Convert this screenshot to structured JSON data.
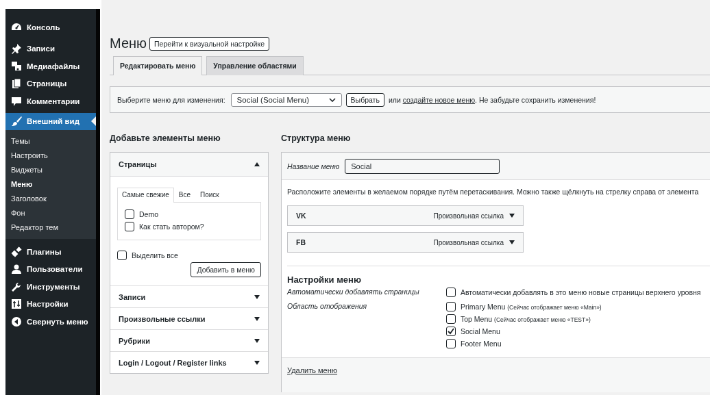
{
  "sidebar": {
    "items": [
      {
        "label": "Консоль",
        "selected": false
      },
      {
        "label": "Записи",
        "selected": false
      },
      {
        "label": "Медиафайлы",
        "selected": false
      },
      {
        "label": "Страницы",
        "selected": false
      },
      {
        "label": "Комментарии",
        "selected": false
      },
      {
        "label": "Внешний вид",
        "selected": true,
        "children": [
          {
            "label": "Темы",
            "selected": false
          },
          {
            "label": "Настроить",
            "selected": false
          },
          {
            "label": "Виджеты",
            "selected": false
          },
          {
            "label": "Меню",
            "selected": true
          },
          {
            "label": "Заголовок",
            "selected": false
          },
          {
            "label": "Фон",
            "selected": false
          },
          {
            "label": "Редактор тем",
            "selected": false
          }
        ]
      },
      {
        "label": "Плагины",
        "selected": false
      },
      {
        "label": "Пользователи",
        "selected": false
      },
      {
        "label": "Инструменты",
        "selected": false
      },
      {
        "label": "Настройки",
        "selected": false
      },
      {
        "label": "Свернуть меню",
        "selected": false
      }
    ]
  },
  "page": {
    "title": "Меню",
    "action_button": "Перейти к визуальной настройке"
  },
  "tabs": [
    {
      "label": "Редактировать меню",
      "selected": true
    },
    {
      "label": "Управление областями",
      "selected": false
    }
  ],
  "menu_select": {
    "label": "Выберите меню для изменения:",
    "value": "Social (Social Menu)",
    "button": "Выбрать",
    "note_before": "или ",
    "link": "создайте новое меню",
    "note_after": ". Не забудьте сохранить изменения!"
  },
  "add_items": {
    "heading": "Добавьте элементы меню",
    "sections": [
      {
        "title": "Страницы",
        "expanded": true,
        "tabs": [
          {
            "label": "Самые свежие",
            "selected": true
          },
          {
            "label": "Все",
            "selected": false
          },
          {
            "label": "Поиск",
            "selected": false
          }
        ],
        "pages": [
          {
            "label": "Demo",
            "checked": false
          },
          {
            "label": "Как стать автором?",
            "checked": false
          }
        ],
        "select_all": {
          "label": "Выделить все",
          "checked": false
        },
        "add_button": "Добавить в меню"
      },
      {
        "title": "Записи",
        "expanded": false
      },
      {
        "title": "Произвольные ссылки",
        "expanded": false
      },
      {
        "title": "Рубрики",
        "expanded": false
      },
      {
        "title": "Login / Logout / Register links",
        "expanded": false
      }
    ]
  },
  "structure": {
    "heading": "Структура меню",
    "name_label": "Название меню",
    "name_value": "Social",
    "instructions": "Расположите элементы в желаемом порядке путём перетаскивания. Можно также щёлкнуть на стрелку справа от элемента",
    "items": [
      {
        "title": "VK",
        "type": "Произвольная ссылка"
      },
      {
        "title": "FB",
        "type": "Произвольная ссылка"
      }
    ],
    "settings": {
      "heading": "Настройки меню",
      "auto_add": {
        "label": "Автоматически добавлять страницы",
        "option": "Автоматически добавлять в это меню новые страницы верхнего уровня",
        "checked": false
      },
      "locations": {
        "label": "Область отображения",
        "options": [
          {
            "name": "Primary Menu",
            "note": "(Сейчас отображает меню «Main»)",
            "checked": false
          },
          {
            "name": "Top Menu",
            "note": "(Сейчас отображает меню «TEST»)",
            "checked": false
          },
          {
            "name": "Social Menu",
            "checked": true
          },
          {
            "name": "Footer Menu",
            "checked": false
          }
        ]
      }
    },
    "delete_link": "Удалить меню"
  }
}
